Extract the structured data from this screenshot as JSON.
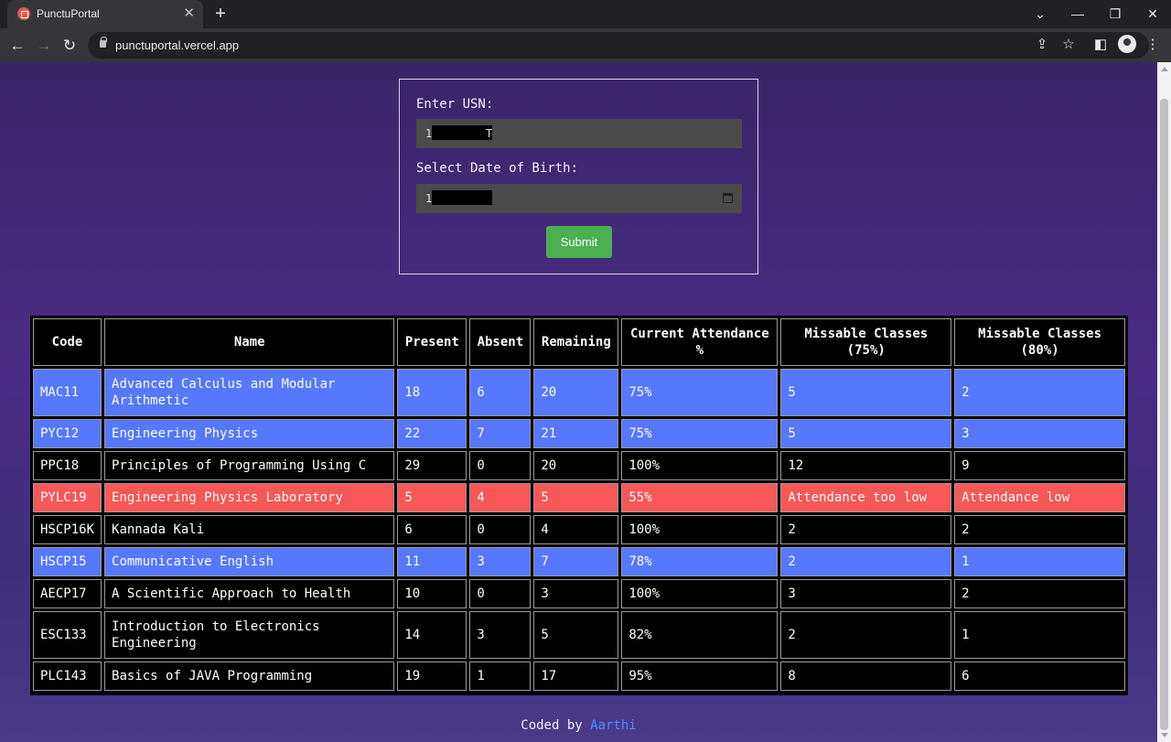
{
  "browser": {
    "tab_title": "PunctuPortal",
    "url": "punctuportal.vercel.app"
  },
  "form": {
    "usn_label": "Enter USN:",
    "usn_value": "1",
    "usn_value_tail": "T",
    "dob_label": "Select Date of Birth:",
    "dob_value": "1",
    "submit_label": "Submit"
  },
  "table": {
    "headers": [
      "Code",
      "Name",
      "Present",
      "Absent",
      "Remaining",
      "Current Attendance %",
      "Missable Classes (75%)",
      "Missable Classes (80%)"
    ],
    "rows": [
      {
        "code": "MAC11",
        "name": "Advanced Calculus and Modular Arithmetic",
        "present": "18",
        "absent": "6",
        "remaining": "20",
        "attendance": "75%",
        "miss75": "5",
        "miss80": "2",
        "status": "good"
      },
      {
        "code": "PYC12",
        "name": "Engineering Physics",
        "present": "22",
        "absent": "7",
        "remaining": "21",
        "attendance": "75%",
        "miss75": "5",
        "miss80": "3",
        "status": "good"
      },
      {
        "code": "PPC18",
        "name": "Principles of Programming Using C",
        "present": "29",
        "absent": "0",
        "remaining": "20",
        "attendance": "100%",
        "miss75": "12",
        "miss80": "9",
        "status": "normal"
      },
      {
        "code": "PYLC19",
        "name": "Engineering Physics Laboratory",
        "present": "5",
        "absent": "4",
        "remaining": "5",
        "attendance": "55%",
        "miss75": "Attendance too low",
        "miss80": "Attendance low",
        "status": "low"
      },
      {
        "code": "HSCP16K",
        "name": "Kannada Kali",
        "present": "6",
        "absent": "0",
        "remaining": "4",
        "attendance": "100%",
        "miss75": "2",
        "miss80": "2",
        "status": "normal"
      },
      {
        "code": "HSCP15",
        "name": "Communicative English",
        "present": "11",
        "absent": "3",
        "remaining": "7",
        "attendance": "78%",
        "miss75": "2",
        "miss80": "1",
        "status": "good"
      },
      {
        "code": "AECP17",
        "name": "A Scientific Approach to Health",
        "present": "10",
        "absent": "0",
        "remaining": "3",
        "attendance": "100%",
        "miss75": "3",
        "miss80": "2",
        "status": "normal"
      },
      {
        "code": "ESC133",
        "name": "Introduction to Electronics Engineering",
        "present": "14",
        "absent": "3",
        "remaining": "5",
        "attendance": "82%",
        "miss75": "2",
        "miss80": "1",
        "status": "normal"
      },
      {
        "code": "PLC143",
        "name": "Basics of JAVA Programming",
        "present": "19",
        "absent": "1",
        "remaining": "17",
        "attendance": "95%",
        "miss75": "8",
        "miss80": "6",
        "status": "normal"
      }
    ]
  },
  "footer": {
    "prefix": "Coded by",
    "author": "Aarthi"
  },
  "colors": {
    "good_row": "#5578ff",
    "low_row": "#f75757",
    "submit": "#4caf50"
  }
}
